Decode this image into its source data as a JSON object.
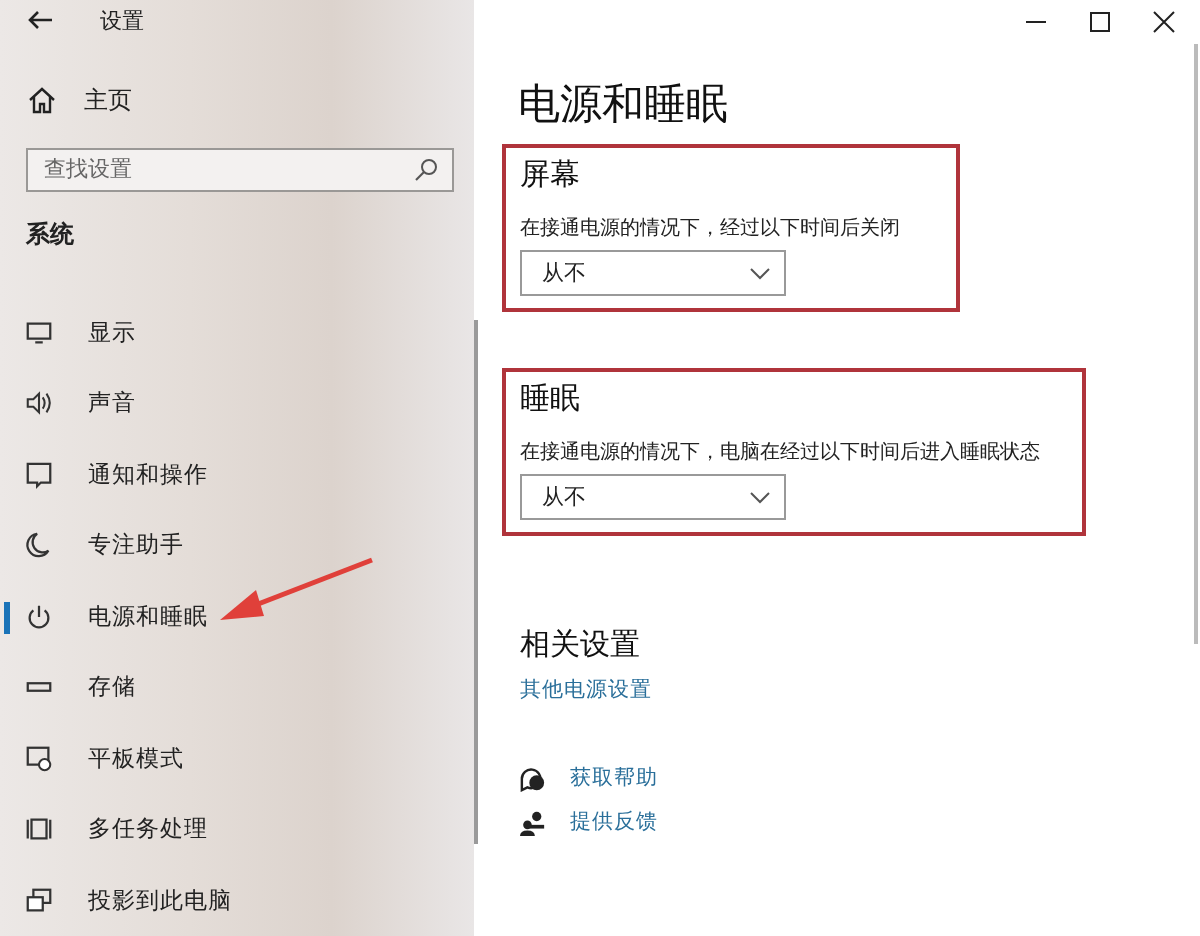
{
  "window": {
    "title": "设置"
  },
  "sidebar": {
    "home": "主页",
    "search": {
      "placeholder": "查找设置"
    },
    "section": "系统",
    "items": [
      {
        "label": "显示",
        "kind": "display",
        "selected": false
      },
      {
        "label": "声音",
        "kind": "sound",
        "selected": false
      },
      {
        "label": "通知和操作",
        "kind": "notify",
        "selected": false
      },
      {
        "label": "专注助手",
        "kind": "moon",
        "selected": false
      },
      {
        "label": "电源和睡眠",
        "kind": "power",
        "selected": true
      },
      {
        "label": "存储",
        "kind": "storage",
        "selected": false
      },
      {
        "label": "平板模式",
        "kind": "tablet",
        "selected": false
      },
      {
        "label": "多任务处理",
        "kind": "multitask",
        "selected": false
      },
      {
        "label": "投影到此电脑",
        "kind": "project",
        "selected": false
      }
    ]
  },
  "page": {
    "title": "电源和睡眠",
    "sections": [
      {
        "title": "屏幕",
        "description": "在接通电源的情况下，经过以下时间后关闭",
        "value": "从不",
        "highlighted": true
      },
      {
        "title": "睡眠",
        "description": "在接通电源的情况下，电脑在经过以下时间后进入睡眠状态",
        "value": "从不",
        "highlighted": true
      }
    ],
    "related": {
      "title": "相关设置",
      "link": "其他电源设置"
    },
    "help": [
      {
        "label": "获取帮助",
        "kind": "help"
      },
      {
        "label": "提供反馈",
        "kind": "feedback"
      }
    ]
  },
  "annotation": {
    "arrow": true
  }
}
